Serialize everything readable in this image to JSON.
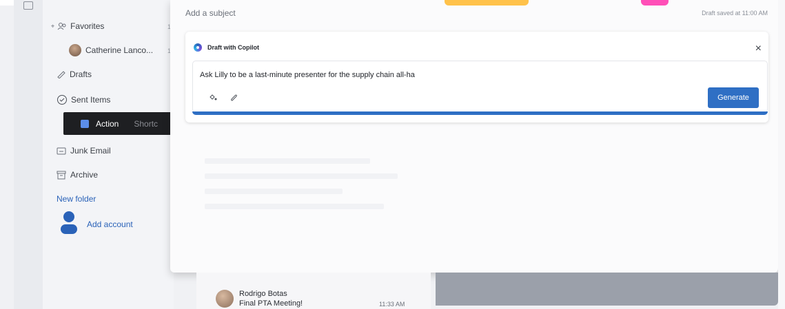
{
  "sidebar": {
    "favorites_label": "Favorites",
    "items": [
      {
        "label": "Catherine Lanco...",
        "icon": "avatar-icon"
      },
      {
        "label": "Drafts",
        "icon": "pencil-icon"
      },
      {
        "label": "Sent Items",
        "icon": "sent-icon"
      },
      {
        "label": "Action",
        "shortcut": "Shortc",
        "icon": "action-icon",
        "active": true
      },
      {
        "label": "Junk Email",
        "icon": "junk-icon"
      },
      {
        "label": "Archive",
        "icon": "archive-icon"
      }
    ],
    "new_folder": "New folder",
    "add_account": "Add account"
  },
  "compose": {
    "subject_placeholder": "Add a subject",
    "draft_status": "Draft saved at 11:00 AM",
    "copilot": {
      "title": "Draft with Copilot",
      "prompt": "Ask Lilly to be a last-minute presenter for the supply chain all-ha",
      "generate_label": "Generate",
      "close_label": "×"
    }
  },
  "mail_list": {
    "item": {
      "sender": "Rodrigo Botas",
      "subject": "Final PTA Meeting!",
      "time": "11:33 AM"
    }
  },
  "colors": {
    "accent": "#2f6fc4",
    "active_nav_bg": "#1e1f22",
    "link": "#2a62b8"
  }
}
